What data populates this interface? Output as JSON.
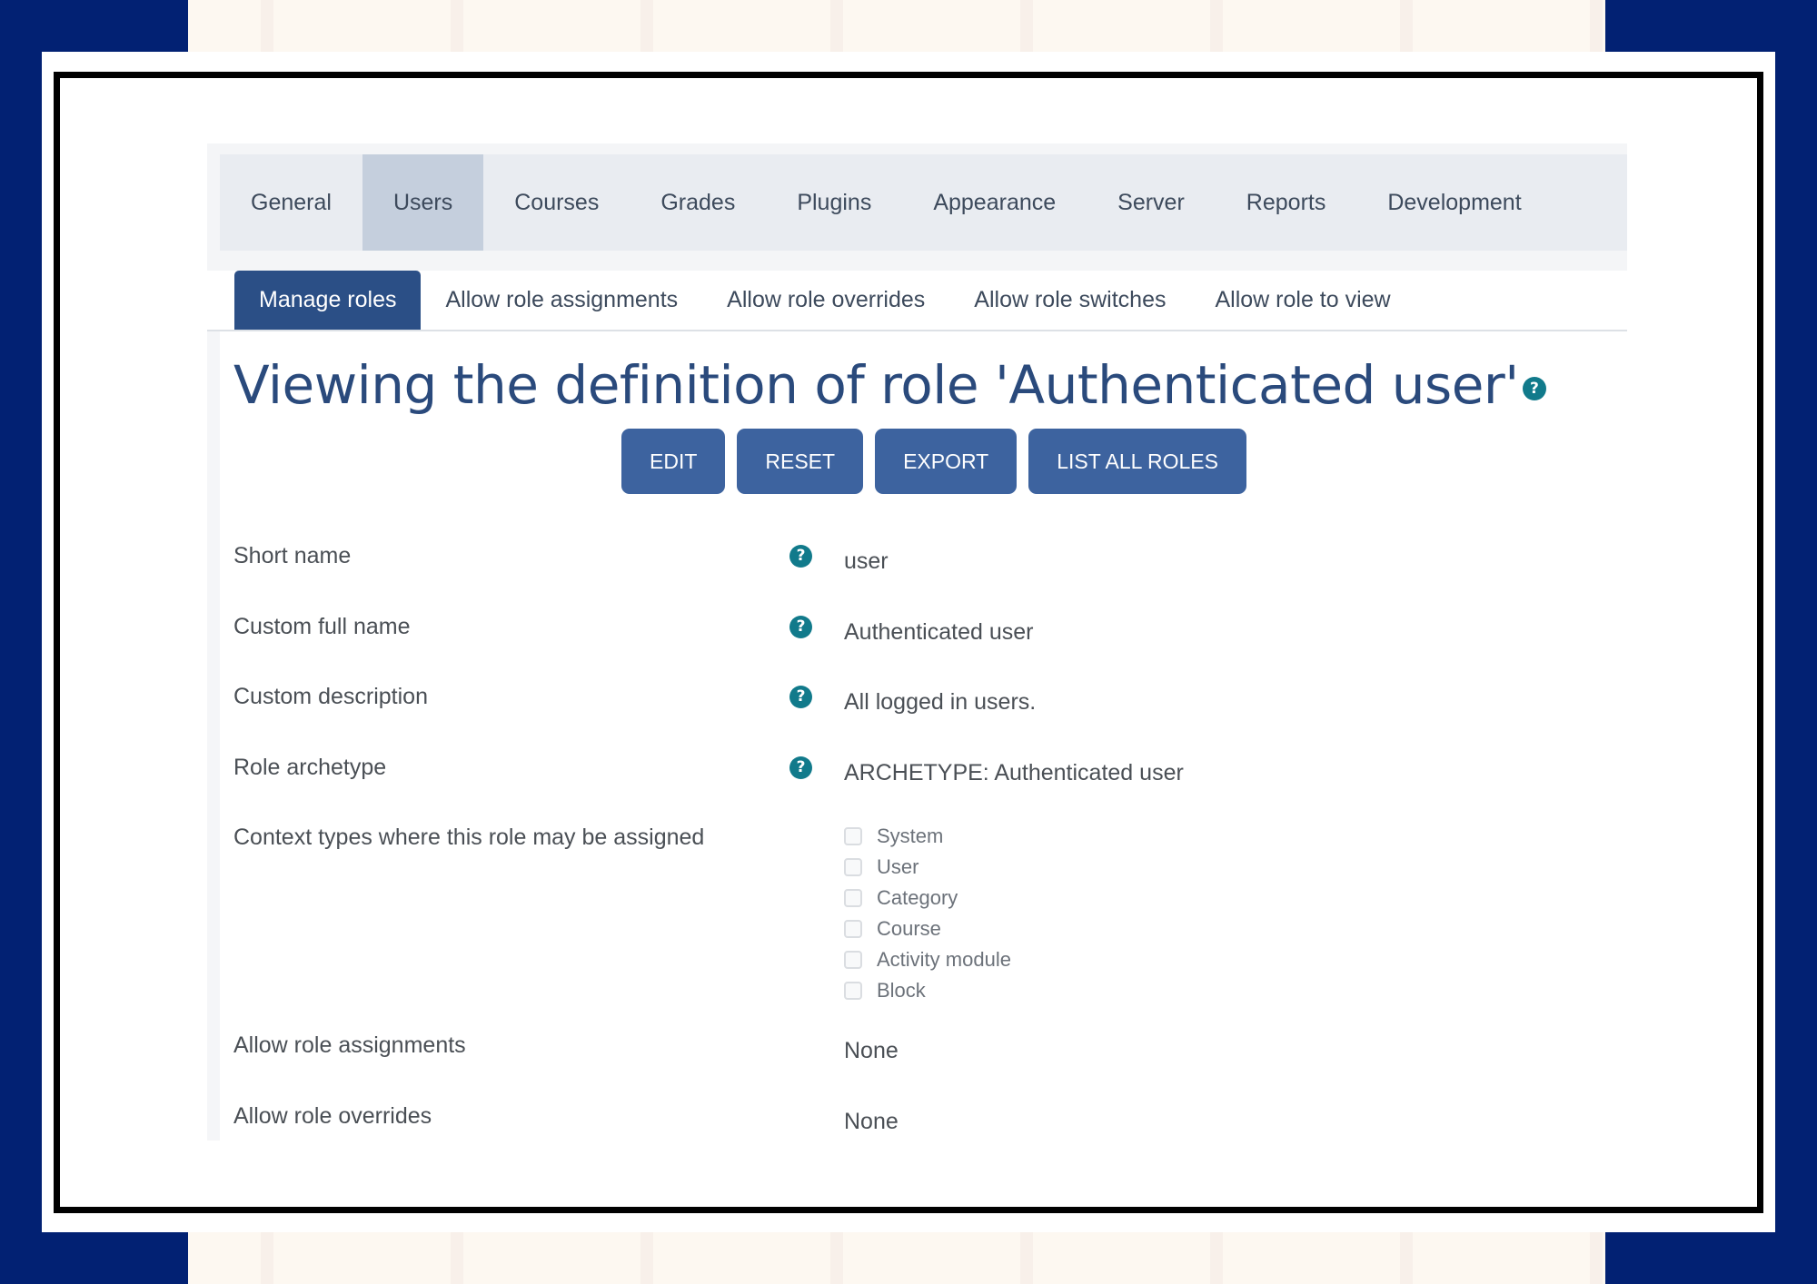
{
  "colors": {
    "frame_blue": "#022173",
    "accent": "#2b4f86",
    "button": "#3d639f",
    "help_icon": "#117a8b",
    "title": "#2a4a7c"
  },
  "primary_nav": [
    {
      "label": "General",
      "active": false
    },
    {
      "label": "Users",
      "active": true
    },
    {
      "label": "Courses",
      "active": false
    },
    {
      "label": "Grades",
      "active": false
    },
    {
      "label": "Plugins",
      "active": false
    },
    {
      "label": "Appearance",
      "active": false
    },
    {
      "label": "Server",
      "active": false
    },
    {
      "label": "Reports",
      "active": false
    },
    {
      "label": "Development",
      "active": false
    }
  ],
  "secondary_nav": [
    {
      "label": "Manage roles",
      "active": true
    },
    {
      "label": "Allow role assignments",
      "active": false
    },
    {
      "label": "Allow role overrides",
      "active": false
    },
    {
      "label": "Allow role switches",
      "active": false
    },
    {
      "label": "Allow role to view",
      "active": false
    }
  ],
  "page": {
    "title": "Viewing the definition of role 'Authenticated user'",
    "help_icon": "question-circle-icon"
  },
  "actions": {
    "edit": "EDIT",
    "reset": "RESET",
    "export": "EXPORT",
    "list_all_roles": "LIST ALL ROLES"
  },
  "fields": {
    "short_name": {
      "label": "Short name",
      "value": "user",
      "help": true
    },
    "custom_full_name": {
      "label": "Custom full name",
      "value": "Authenticated user",
      "help": true
    },
    "custom_description": {
      "label": "Custom description",
      "value": "All logged in users.",
      "help": true
    },
    "role_archetype": {
      "label": "Role archetype",
      "value": "ARCHETYPE: Authenticated user",
      "help": true
    },
    "context_types": {
      "label": "Context types where this role may be assigned",
      "options": [
        {
          "label": "System",
          "checked": false
        },
        {
          "label": "User",
          "checked": false
        },
        {
          "label": "Category",
          "checked": false
        },
        {
          "label": "Course",
          "checked": false
        },
        {
          "label": "Activity module",
          "checked": false
        },
        {
          "label": "Block",
          "checked": false
        }
      ]
    },
    "allow_role_assignments": {
      "label": "Allow role assignments",
      "value": "None"
    },
    "allow_role_overrides": {
      "label": "Allow role overrides",
      "value": "None"
    }
  },
  "help_glyph": "?"
}
